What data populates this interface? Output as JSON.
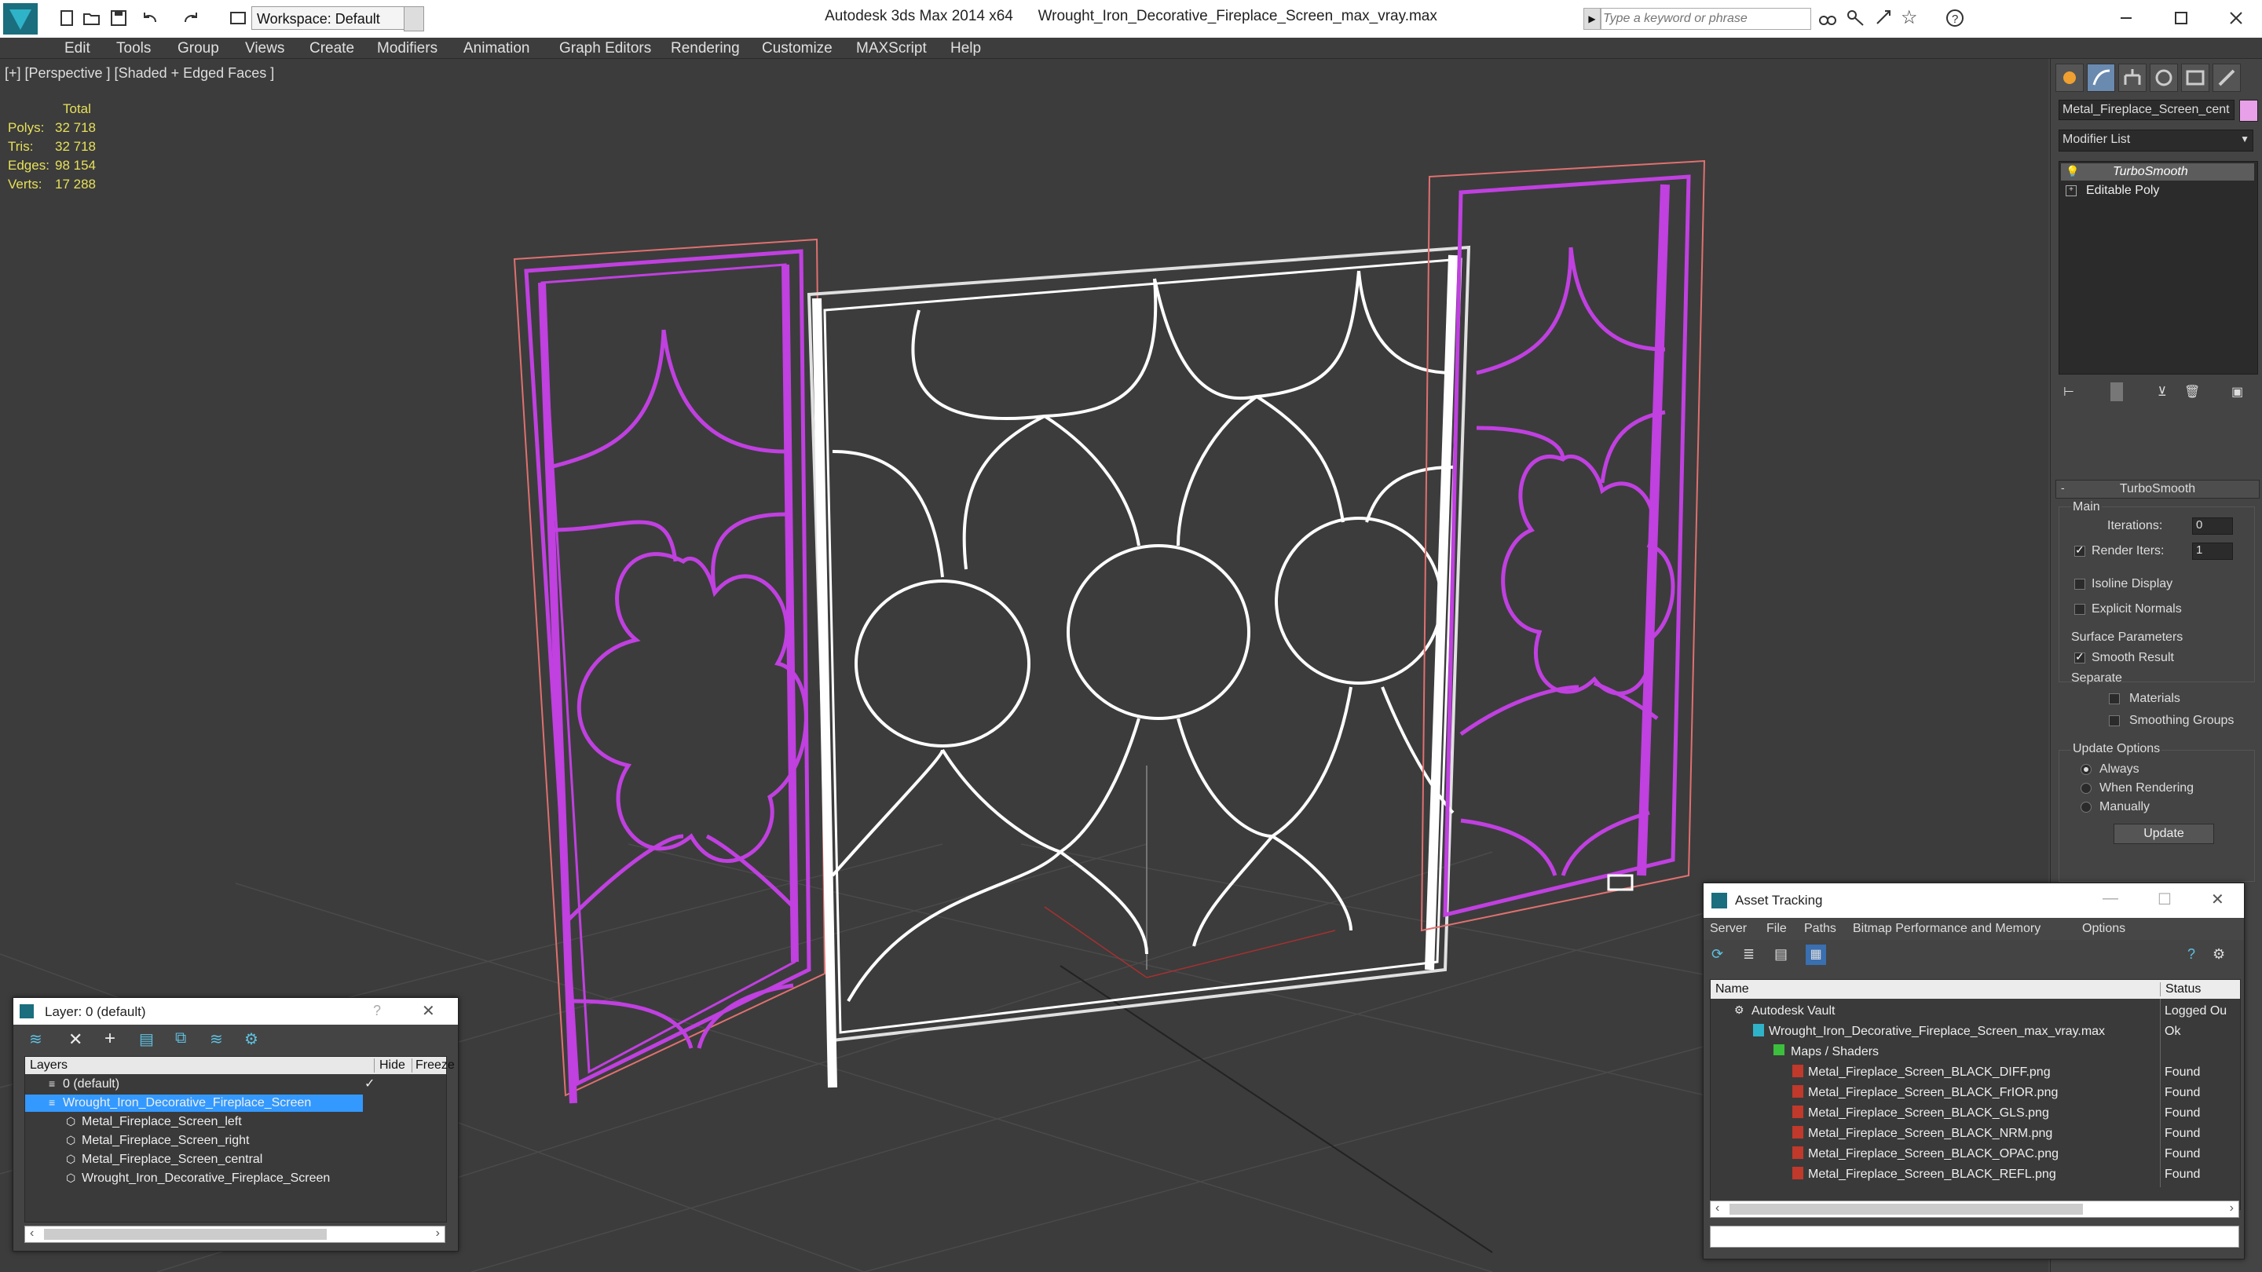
{
  "titlebar": {
    "app_title": "Autodesk 3ds Max  2014 x64",
    "file_title": "Wrought_Iron_Decorative_Fireplace_Screen_max_vray.max",
    "workspace": "Workspace: Default",
    "search_placeholder": "Type a keyword or phrase"
  },
  "menu": [
    "Edit",
    "Tools",
    "Group",
    "Views",
    "Create",
    "Modifiers",
    "Animation",
    "Graph Editors",
    "Rendering",
    "Customize",
    "MAXScript",
    "Help"
  ],
  "viewport": {
    "label": "[+] [Perspective ] [Shaded + Edged Faces ]",
    "stats": {
      "header": "Total",
      "polys_label": "Polys:",
      "polys": "32 718",
      "tris_label": "Tris:",
      "tris": "32 718",
      "edges_label": "Edges:",
      "edges": "98 154",
      "verts_label": "Verts:",
      "verts": "17 288"
    }
  },
  "command_panel": {
    "object_name": "Metal_Fireplace_Screen_cent",
    "modifier_list": "Modifier List",
    "stack": [
      "TurboSmooth",
      "Editable Poly"
    ],
    "rollout_title": "TurboSmooth",
    "main_label": "Main",
    "iterations_label": "Iterations:",
    "iterations": "0",
    "render_iters_label": "Render Iters:",
    "render_iters": "1",
    "isoline_label": "Isoline Display",
    "explicit_label": "Explicit Normals",
    "surface_label": "Surface Parameters",
    "smooth_label": "Smooth Result",
    "separate_label": "Separate",
    "materials_label": "Materials",
    "smoothing_label": "Smoothing Groups",
    "update_label": "Update Options",
    "always_label": "Always",
    "when_label": "When Rendering",
    "manually_label": "Manually",
    "update_btn": "Update"
  },
  "layer_window": {
    "title": "Layer: 0 (default)",
    "col_layers": "Layers",
    "col_hide": "Hide",
    "col_freeze": "Freeze",
    "rows": [
      "0 (default)",
      "Wrought_Iron_Decorative_Fireplace_Screen",
      "Metal_Fireplace_Screen_left",
      "Metal_Fireplace_Screen_right",
      "Metal_Fireplace_Screen_central",
      "Wrought_Iron_Decorative_Fireplace_Screen"
    ]
  },
  "asset_window": {
    "title": "Asset Tracking",
    "menu": [
      "Server",
      "File",
      "Paths",
      "Bitmap Performance and Memory",
      "Options"
    ],
    "col_name": "Name",
    "col_status": "Status",
    "rows": [
      {
        "name": "Autodesk Vault",
        "status": "Logged Ou"
      },
      {
        "name": "Wrought_Iron_Decorative_Fireplace_Screen_max_vray.max",
        "status": "Ok"
      },
      {
        "name": "Maps / Shaders",
        "status": ""
      },
      {
        "name": "Metal_Fireplace_Screen_BLACK_DIFF.png",
        "status": "Found"
      },
      {
        "name": "Metal_Fireplace_Screen_BLACK_FrIOR.png",
        "status": "Found"
      },
      {
        "name": "Metal_Fireplace_Screen_BLACK_GLS.png",
        "status": "Found"
      },
      {
        "name": "Metal_Fireplace_Screen_BLACK_NRM.png",
        "status": "Found"
      },
      {
        "name": "Metal_Fireplace_Screen_BLACK_OPAC.png",
        "status": "Found"
      },
      {
        "name": "Metal_Fireplace_Screen_BLACK_REFL.png",
        "status": "Found"
      }
    ]
  },
  "colors": {
    "selection_magenta": "#c040e0",
    "wire_white": "#ffffff",
    "stats_yellow": "#e6e05a",
    "highlight_blue": "#3399ff"
  }
}
